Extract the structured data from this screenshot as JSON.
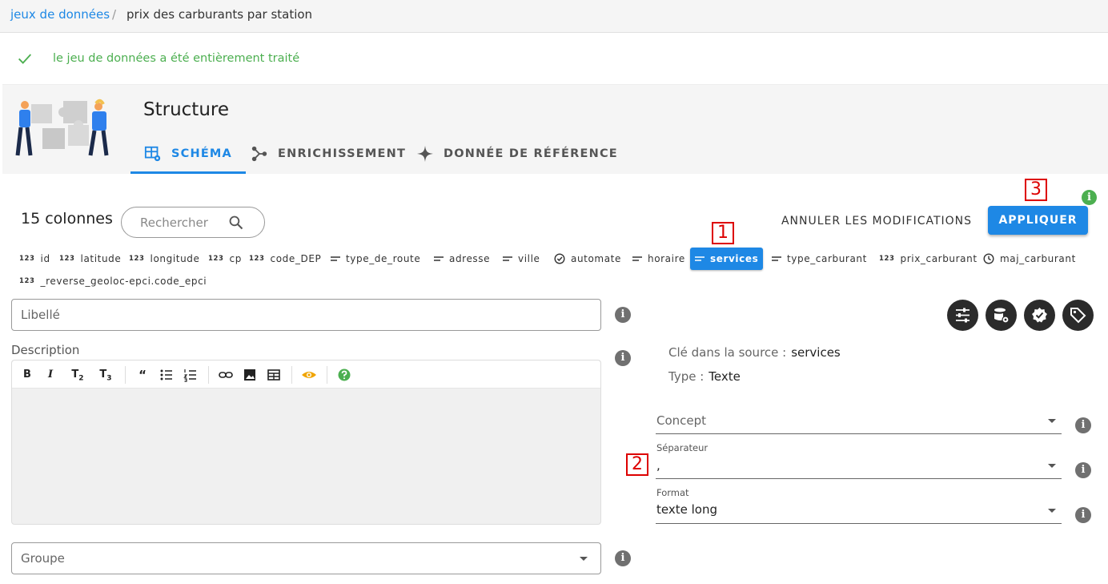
{
  "breadcrumb": {
    "link": "jeux de données",
    "separator": "/",
    "current": "prix des carburants par station"
  },
  "status": {
    "message": "le jeu de données a été entièrement traité",
    "color": "#4caf50"
  },
  "structure": {
    "title": "Structure",
    "tabs": [
      {
        "label": "SCHÉMA",
        "icon": "table-cog-icon",
        "active": true
      },
      {
        "label": "ENRICHISSEMENT",
        "icon": "graph-icon",
        "active": false
      },
      {
        "label": "DONNÉE DE RÉFÉRENCE",
        "icon": "star-four-points-icon",
        "active": false
      }
    ]
  },
  "toolbar": {
    "count": "15 colonnes",
    "search_placeholder": "Rechercher",
    "cancel_label": "ANNULER LES MODIFICATIONS",
    "apply_label": "APPLIQUER",
    "accent": "#1e88e5"
  },
  "annotations": [
    "1",
    "2",
    "3"
  ],
  "columns": [
    {
      "name": "id",
      "type": "number"
    },
    {
      "name": "latitude",
      "type": "number"
    },
    {
      "name": "longitude",
      "type": "number"
    },
    {
      "name": "cp",
      "type": "number"
    },
    {
      "name": "code_DEP",
      "type": "number"
    },
    {
      "name": "type_de_route",
      "type": "text"
    },
    {
      "name": "adresse",
      "type": "text"
    },
    {
      "name": "ville",
      "type": "text"
    },
    {
      "name": "automate",
      "type": "boolean"
    },
    {
      "name": "horaire",
      "type": "text"
    },
    {
      "name": "services",
      "type": "text",
      "active": true
    },
    {
      "name": "type_carburant",
      "type": "text"
    },
    {
      "name": "prix_carburant",
      "type": "number"
    },
    {
      "name": "maj_carburant",
      "type": "date"
    },
    {
      "name": "_reverse_geoloc-epci.code_epci",
      "type": "number"
    }
  ],
  "form": {
    "libelle_placeholder": "Libellé",
    "description_label": "Description",
    "groupe_placeholder": "Groupe"
  },
  "details": {
    "source_key_label": "Clé dans la source :",
    "source_key_value": "services",
    "type_label": "Type :",
    "type_value": "Texte",
    "concept_placeholder": "Concept",
    "separator_label": "Séparateur",
    "separator_value": ",",
    "format_label": "Format",
    "format_value": "texte long"
  },
  "editor_tools": [
    "bold-icon",
    "italic-icon",
    "heading2-icon",
    "heading3-icon",
    "quote-icon",
    "bullet-list-icon",
    "numbered-list-icon",
    "link-icon",
    "image-icon",
    "table-icon",
    "preview-eye-icon",
    "help-icon"
  ]
}
